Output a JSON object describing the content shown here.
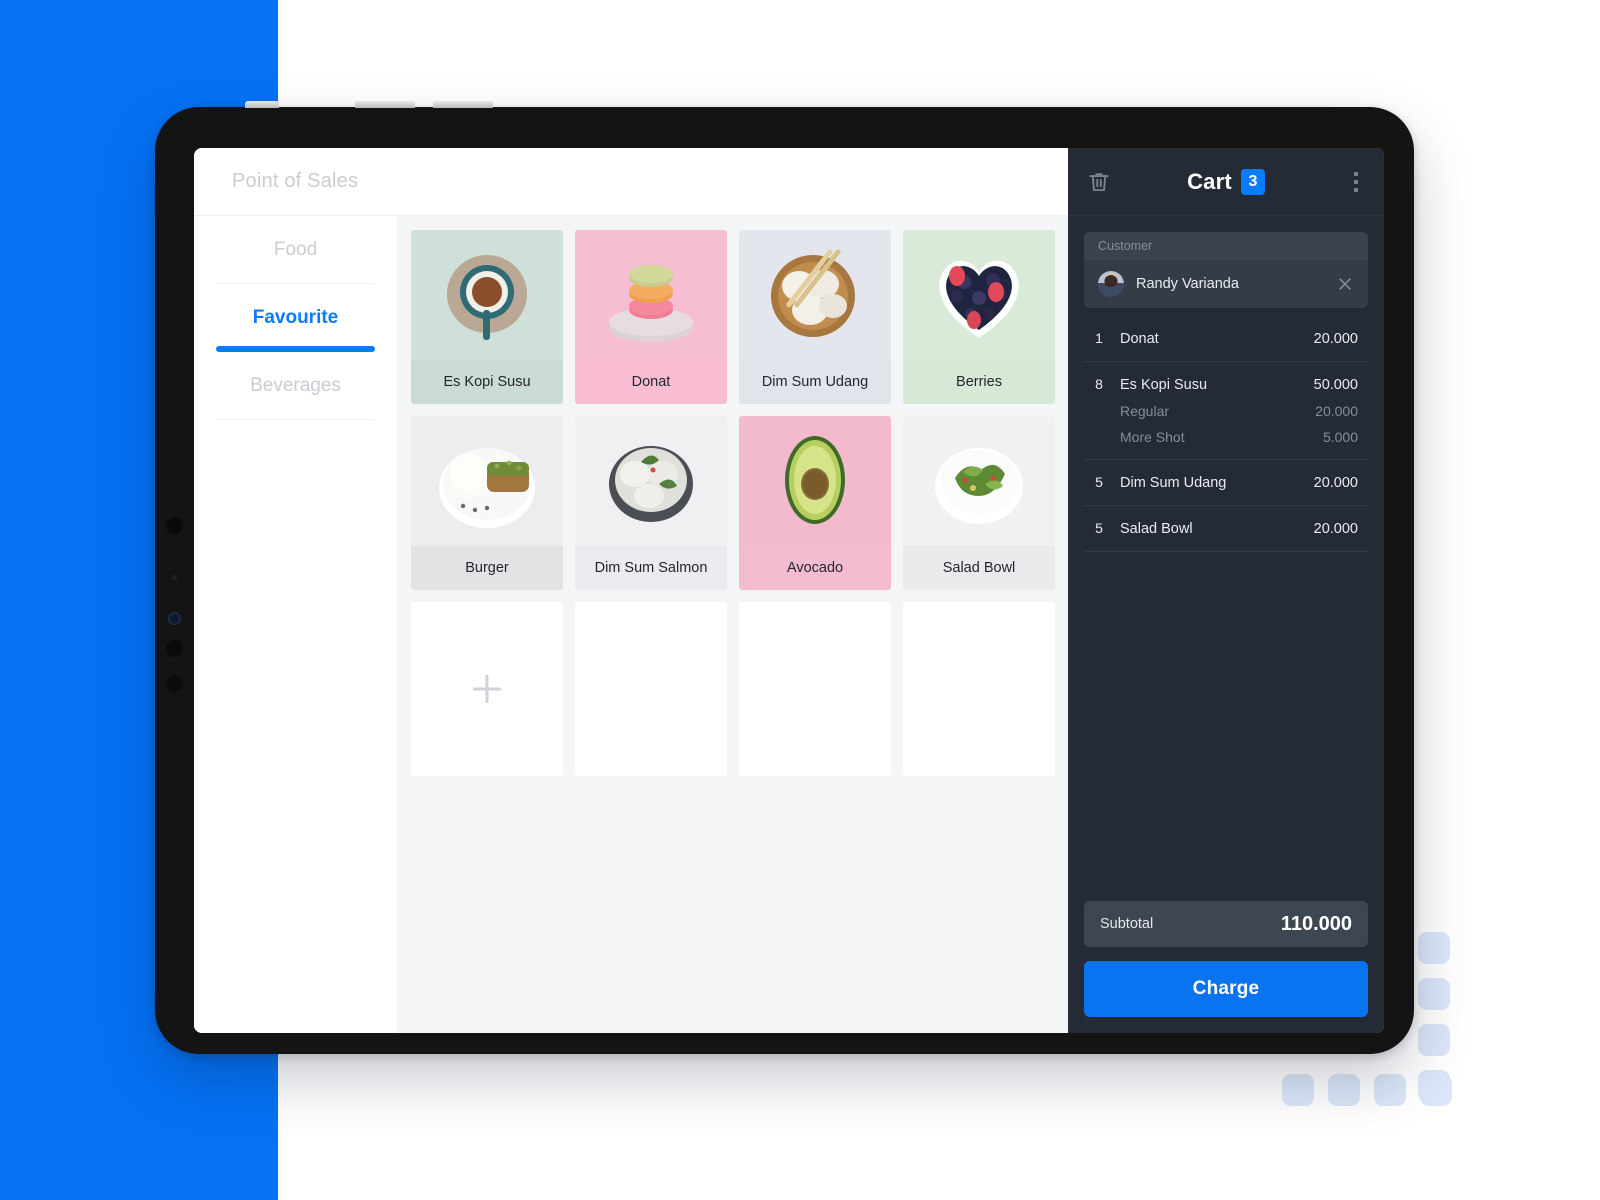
{
  "app": {
    "title": "Point of Sales"
  },
  "categories": [
    {
      "label": "Food",
      "active": false
    },
    {
      "label": "Favourite",
      "active": true
    },
    {
      "label": "Beverages",
      "active": false
    }
  ],
  "products": [
    {
      "label": "Es Kopi Susu",
      "bg": "#cfdfda",
      "cap_bg": "#cbdbd5",
      "art": "coffee"
    },
    {
      "label": "Donat",
      "bg": "#f7bdd2",
      "cap_bg": "#f8bdd3",
      "art": "macaron"
    },
    {
      "label": "Dim Sum Udang",
      "bg": "#e4e6ed",
      "cap_bg": "#e2e4ec",
      "art": "dimsum-bowl"
    },
    {
      "label": "Berries",
      "bg": "#d9ead9",
      "cap_bg": "#d7e8d7",
      "art": "berries"
    },
    {
      "label": "Burger",
      "bg": "#ededef",
      "cap_bg": "#e3e3e6",
      "art": "burger"
    },
    {
      "label": "Dim Sum Salmon",
      "bg": "#f0eff1",
      "cap_bg": "#eceaee",
      "art": "dimsum-dark"
    },
    {
      "label": "Avocado",
      "bg": "#f3b9cd",
      "cap_bg": "#f4bad0",
      "art": "avocado"
    },
    {
      "label": "Salad Bowl",
      "bg": "#f1f0f2",
      "cap_bg": "#eaeaec",
      "art": "salad"
    }
  ],
  "empty_slots": [
    {
      "name": "add-product",
      "has_plus": true
    },
    {
      "name": "empty-slot-2",
      "has_plus": false
    },
    {
      "name": "empty-slot-3",
      "has_plus": false
    },
    {
      "name": "empty-slot-4",
      "has_plus": false
    }
  ],
  "cart": {
    "title": "Cart",
    "badge": "3",
    "trash_icon": "trash-icon",
    "menu_icon": "kebab-menu-icon",
    "customer": {
      "label": "Customer",
      "name": "Randy Varianda",
      "remove_icon": "close-icon"
    },
    "items": [
      {
        "qty": "1",
        "name": "Donat",
        "price": "20.000",
        "modifiers": []
      },
      {
        "qty": "8",
        "name": "Es Kopi Susu",
        "price": "50.000",
        "modifiers": [
          {
            "name": "Regular",
            "price": "20.000"
          },
          {
            "name": "More Shot",
            "price": "5.000"
          }
        ]
      },
      {
        "qty": "5",
        "name": "Dim Sum Udang",
        "price": "20.000",
        "modifiers": []
      },
      {
        "qty": "5",
        "name": "Salad Bowl",
        "price": "20.000",
        "modifiers": []
      }
    ],
    "subtotal_label": "Subtotal",
    "subtotal_value": "110.000",
    "charge_label": "Charge"
  },
  "colors": {
    "brand_blue": "#0572f5",
    "accent_blue": "#0a7cff",
    "charge_blue": "#0a73f0",
    "cart_bg": "#242b36",
    "cart_row_bg": "#343c47",
    "subtotal_bg": "#3e4652",
    "grid_bg": "#f4f5f7",
    "decor_square": "#dbe7f8"
  }
}
